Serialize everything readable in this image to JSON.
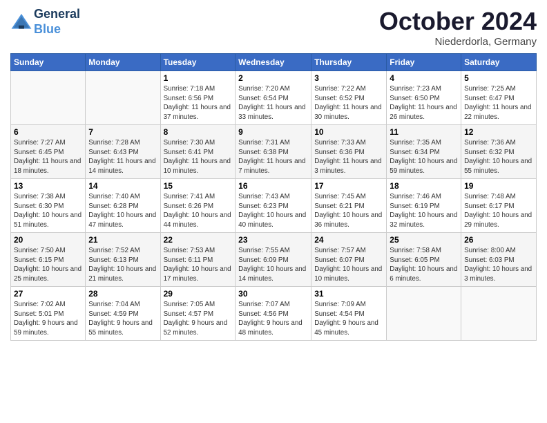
{
  "header": {
    "logo_line1": "General",
    "logo_line2": "Blue",
    "month": "October 2024",
    "location": "Niederdorla, Germany"
  },
  "weekdays": [
    "Sunday",
    "Monday",
    "Tuesday",
    "Wednesday",
    "Thursday",
    "Friday",
    "Saturday"
  ],
  "weeks": [
    [
      {
        "day": "",
        "info": ""
      },
      {
        "day": "",
        "info": ""
      },
      {
        "day": "1",
        "info": "Sunrise: 7:18 AM\nSunset: 6:56 PM\nDaylight: 11 hours and 37 minutes."
      },
      {
        "day": "2",
        "info": "Sunrise: 7:20 AM\nSunset: 6:54 PM\nDaylight: 11 hours and 33 minutes."
      },
      {
        "day": "3",
        "info": "Sunrise: 7:22 AM\nSunset: 6:52 PM\nDaylight: 11 hours and 30 minutes."
      },
      {
        "day": "4",
        "info": "Sunrise: 7:23 AM\nSunset: 6:50 PM\nDaylight: 11 hours and 26 minutes."
      },
      {
        "day": "5",
        "info": "Sunrise: 7:25 AM\nSunset: 6:47 PM\nDaylight: 11 hours and 22 minutes."
      }
    ],
    [
      {
        "day": "6",
        "info": "Sunrise: 7:27 AM\nSunset: 6:45 PM\nDaylight: 11 hours and 18 minutes."
      },
      {
        "day": "7",
        "info": "Sunrise: 7:28 AM\nSunset: 6:43 PM\nDaylight: 11 hours and 14 minutes."
      },
      {
        "day": "8",
        "info": "Sunrise: 7:30 AM\nSunset: 6:41 PM\nDaylight: 11 hours and 10 minutes."
      },
      {
        "day": "9",
        "info": "Sunrise: 7:31 AM\nSunset: 6:38 PM\nDaylight: 11 hours and 7 minutes."
      },
      {
        "day": "10",
        "info": "Sunrise: 7:33 AM\nSunset: 6:36 PM\nDaylight: 11 hours and 3 minutes."
      },
      {
        "day": "11",
        "info": "Sunrise: 7:35 AM\nSunset: 6:34 PM\nDaylight: 10 hours and 59 minutes."
      },
      {
        "day": "12",
        "info": "Sunrise: 7:36 AM\nSunset: 6:32 PM\nDaylight: 10 hours and 55 minutes."
      }
    ],
    [
      {
        "day": "13",
        "info": "Sunrise: 7:38 AM\nSunset: 6:30 PM\nDaylight: 10 hours and 51 minutes."
      },
      {
        "day": "14",
        "info": "Sunrise: 7:40 AM\nSunset: 6:28 PM\nDaylight: 10 hours and 47 minutes."
      },
      {
        "day": "15",
        "info": "Sunrise: 7:41 AM\nSunset: 6:26 PM\nDaylight: 10 hours and 44 minutes."
      },
      {
        "day": "16",
        "info": "Sunrise: 7:43 AM\nSunset: 6:23 PM\nDaylight: 10 hours and 40 minutes."
      },
      {
        "day": "17",
        "info": "Sunrise: 7:45 AM\nSunset: 6:21 PM\nDaylight: 10 hours and 36 minutes."
      },
      {
        "day": "18",
        "info": "Sunrise: 7:46 AM\nSunset: 6:19 PM\nDaylight: 10 hours and 32 minutes."
      },
      {
        "day": "19",
        "info": "Sunrise: 7:48 AM\nSunset: 6:17 PM\nDaylight: 10 hours and 29 minutes."
      }
    ],
    [
      {
        "day": "20",
        "info": "Sunrise: 7:50 AM\nSunset: 6:15 PM\nDaylight: 10 hours and 25 minutes."
      },
      {
        "day": "21",
        "info": "Sunrise: 7:52 AM\nSunset: 6:13 PM\nDaylight: 10 hours and 21 minutes."
      },
      {
        "day": "22",
        "info": "Sunrise: 7:53 AM\nSunset: 6:11 PM\nDaylight: 10 hours and 17 minutes."
      },
      {
        "day": "23",
        "info": "Sunrise: 7:55 AM\nSunset: 6:09 PM\nDaylight: 10 hours and 14 minutes."
      },
      {
        "day": "24",
        "info": "Sunrise: 7:57 AM\nSunset: 6:07 PM\nDaylight: 10 hours and 10 minutes."
      },
      {
        "day": "25",
        "info": "Sunrise: 7:58 AM\nSunset: 6:05 PM\nDaylight: 10 hours and 6 minutes."
      },
      {
        "day": "26",
        "info": "Sunrise: 8:00 AM\nSunset: 6:03 PM\nDaylight: 10 hours and 3 minutes."
      }
    ],
    [
      {
        "day": "27",
        "info": "Sunrise: 7:02 AM\nSunset: 5:01 PM\nDaylight: 9 hours and 59 minutes."
      },
      {
        "day": "28",
        "info": "Sunrise: 7:04 AM\nSunset: 4:59 PM\nDaylight: 9 hours and 55 minutes."
      },
      {
        "day": "29",
        "info": "Sunrise: 7:05 AM\nSunset: 4:57 PM\nDaylight: 9 hours and 52 minutes."
      },
      {
        "day": "30",
        "info": "Sunrise: 7:07 AM\nSunset: 4:56 PM\nDaylight: 9 hours and 48 minutes."
      },
      {
        "day": "31",
        "info": "Sunrise: 7:09 AM\nSunset: 4:54 PM\nDaylight: 9 hours and 45 minutes."
      },
      {
        "day": "",
        "info": ""
      },
      {
        "day": "",
        "info": ""
      }
    ]
  ]
}
